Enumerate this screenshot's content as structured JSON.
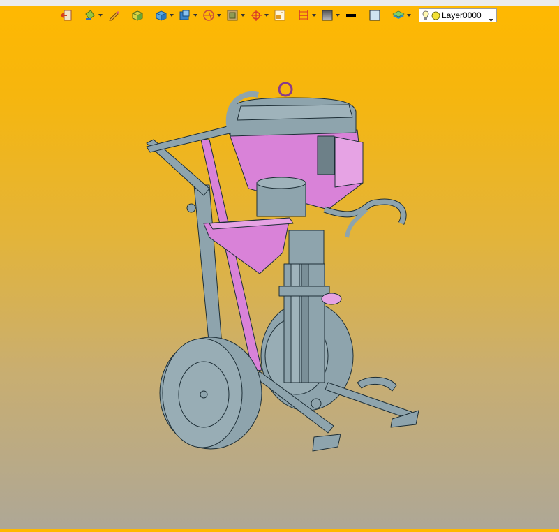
{
  "toolbar": {
    "buttons": [
      {
        "name": "exit-icon"
      },
      {
        "name": "paint-bucket-icon",
        "dropdown": true
      },
      {
        "name": "pencil-icon"
      },
      {
        "name": "solid-box-yellow-icon"
      },
      {
        "name": "solid-box-blue-icon",
        "dropdown": true
      },
      {
        "name": "view-cube-icon",
        "dropdown": true
      },
      {
        "name": "section-icon",
        "dropdown": true
      },
      {
        "name": "shaded-view-icon",
        "dropdown": true
      },
      {
        "name": "snap-target-icon",
        "dropdown": true
      },
      {
        "name": "properties-icon"
      },
      {
        "name": "dimension-icon",
        "dropdown": true
      },
      {
        "name": "background-icon",
        "dropdown": true
      },
      {
        "name": "line-color-icon"
      },
      {
        "name": "fill-color-icon"
      },
      {
        "name": "layers-icon",
        "dropdown": true
      }
    ],
    "layer": {
      "name": "Layer0000",
      "bulb_icon": "lightbulb-icon",
      "color_icon": "yellow-circle-icon"
    }
  },
  "colors": {
    "background_top": "#ffb800",
    "background_bottom": "#aea796",
    "model_steel": "#8ea4ad",
    "model_magenta": "#d982d8"
  }
}
